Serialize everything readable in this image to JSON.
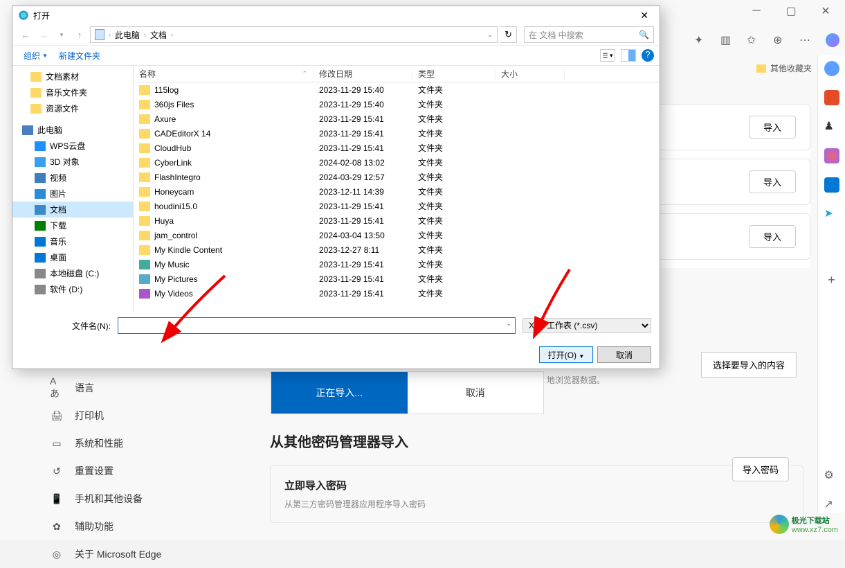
{
  "dialog": {
    "title": "打开",
    "breadcrumb": {
      "root": "此电脑",
      "folder": "文档"
    },
    "search_placeholder": "在 文档 中搜索",
    "toolbar": {
      "organize": "组织",
      "new_folder": "新建文件夹"
    },
    "tree": {
      "quick": [
        "文档素材",
        "音乐文件夹",
        "资源文件"
      ],
      "this_pc": "此电脑",
      "items": [
        {
          "label": "WPS云盘",
          "icon": "#1e90ff"
        },
        {
          "label": "3D 对象",
          "icon": "#39a0ed"
        },
        {
          "label": "视频",
          "icon": "#3c7ebf"
        },
        {
          "label": "图片",
          "icon": "#2b8bd4"
        },
        {
          "label": "文档",
          "icon": "#3a89c9",
          "active": true
        },
        {
          "label": "下载",
          "icon": "#008000"
        },
        {
          "label": "音乐",
          "icon": "#0078d7"
        },
        {
          "label": "桌面",
          "icon": "#0078d7"
        },
        {
          "label": "本地磁盘 (C:)",
          "icon": "#888"
        },
        {
          "label": "软件 (D:)",
          "icon": "#888"
        }
      ]
    },
    "columns": {
      "name": "名称",
      "date": "修改日期",
      "type": "类型",
      "size": "大小"
    },
    "files": [
      {
        "name": "115log",
        "date": "2023-11-29 15:40",
        "type": "文件夹",
        "icon": "folder"
      },
      {
        "name": "360js Files",
        "date": "2023-11-29 15:40",
        "type": "文件夹",
        "icon": "folder"
      },
      {
        "name": "Axure",
        "date": "2023-11-29 15:41",
        "type": "文件夹",
        "icon": "folder"
      },
      {
        "name": "CADEditorX 14",
        "date": "2023-11-29 15:41",
        "type": "文件夹",
        "icon": "folder"
      },
      {
        "name": "CloudHub",
        "date": "2023-11-29 15:41",
        "type": "文件夹",
        "icon": "folder"
      },
      {
        "name": "CyberLink",
        "date": "2024-02-08 13:02",
        "type": "文件夹",
        "icon": "folder"
      },
      {
        "name": "FlashIntegro",
        "date": "2024-03-29 12:57",
        "type": "文件夹",
        "icon": "folder"
      },
      {
        "name": "Honeycam",
        "date": "2023-12-11 14:39",
        "type": "文件夹",
        "icon": "folder"
      },
      {
        "name": "houdini15.0",
        "date": "2023-11-29 15:41",
        "type": "文件夹",
        "icon": "folder"
      },
      {
        "name": "Huya",
        "date": "2023-11-29 15:41",
        "type": "文件夹",
        "icon": "folder"
      },
      {
        "name": "jam_control",
        "date": "2024-03-04 13:50",
        "type": "文件夹",
        "icon": "folder"
      },
      {
        "name": "My Kindle Content",
        "date": "2023-12-27 8:11",
        "type": "文件夹",
        "icon": "folder"
      },
      {
        "name": "My Music",
        "date": "2023-11-29 15:41",
        "type": "文件夹",
        "icon": "music"
      },
      {
        "name": "My Pictures",
        "date": "2023-11-29 15:41",
        "type": "文件夹",
        "icon": "pictures"
      },
      {
        "name": "My Videos",
        "date": "2023-11-29 15:41",
        "type": "文件夹",
        "icon": "videos"
      }
    ],
    "filename_label": "文件名(N):",
    "filetype": "XLS 工作表 (*.csv)",
    "open_btn": "打开(O)",
    "cancel_btn": "取消"
  },
  "edge": {
    "other_bookmarks": "其他收藏夹",
    "nav": [
      {
        "label": "语言",
        "icon": "language"
      },
      {
        "label": "打印机",
        "icon": "printer"
      },
      {
        "label": "系统和性能",
        "icon": "system"
      },
      {
        "label": "重置设置",
        "icon": "reset"
      },
      {
        "label": "手机和其他设备",
        "icon": "phone"
      },
      {
        "label": "辅助功能",
        "icon": "accessibility"
      },
      {
        "label": "关于 Microsoft Edge",
        "icon": "edge"
      }
    ],
    "import_btn": "导入",
    "importing": "正在导入...",
    "importing_cancel": "取消",
    "select_content": "选择要导入的内容",
    "browser_data": "地浏览器数据。",
    "password_section": {
      "title": "从其他密码管理器导入",
      "card_title": "立即导入密码",
      "card_desc": "从第三方密码管理器应用程序导入密码",
      "btn": "导入密码"
    }
  },
  "watermark": {
    "name": "极光下载站",
    "url": "www.xz7.com"
  }
}
